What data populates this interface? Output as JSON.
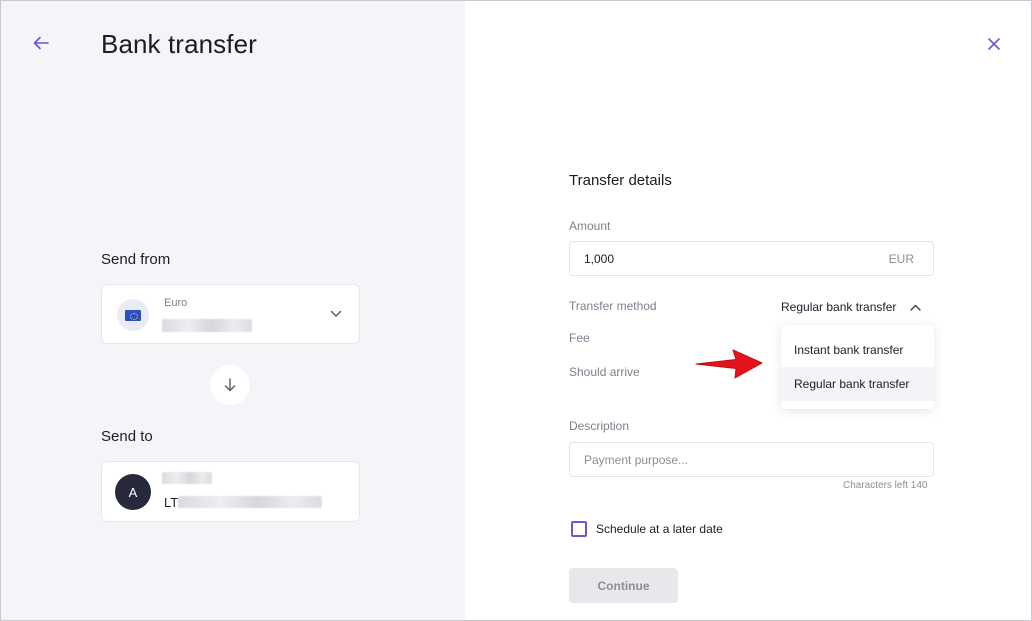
{
  "header": {
    "title": "Bank transfer"
  },
  "send_from": {
    "label": "Send from",
    "account_currency": "Euro"
  },
  "send_to": {
    "label": "Send to",
    "avatar_initial": "A",
    "iban_prefix": "LT"
  },
  "transfer": {
    "title": "Transfer details",
    "amount_label": "Amount",
    "amount_value": "1,000",
    "currency": "EUR",
    "method_label": "Transfer method",
    "method_value": "Regular bank transfer",
    "fee_label": "Fee",
    "arrive_label": "Should arrive",
    "method_options": [
      "Instant bank transfer",
      "Regular bank transfer"
    ],
    "description_label": "Description",
    "description_placeholder": "Payment purpose...",
    "chars_left": "Characters left 140",
    "schedule_label": "Schedule at a later date",
    "continue_label": "Continue"
  },
  "icons": {
    "back": "arrow-left-icon",
    "close": "close-icon",
    "dropdown": "chevron-down-icon",
    "swap": "arrow-down-icon",
    "method_toggle": "chevron-up-icon",
    "annotation": "red-arrow-icon"
  },
  "colors": {
    "accent": "#6b55d8",
    "left_panel_bg": "#f4f5f9",
    "avatar_bg": "#262a3c",
    "annotation_red": "#e3141b",
    "button_disabled": "#e8e8ec"
  }
}
